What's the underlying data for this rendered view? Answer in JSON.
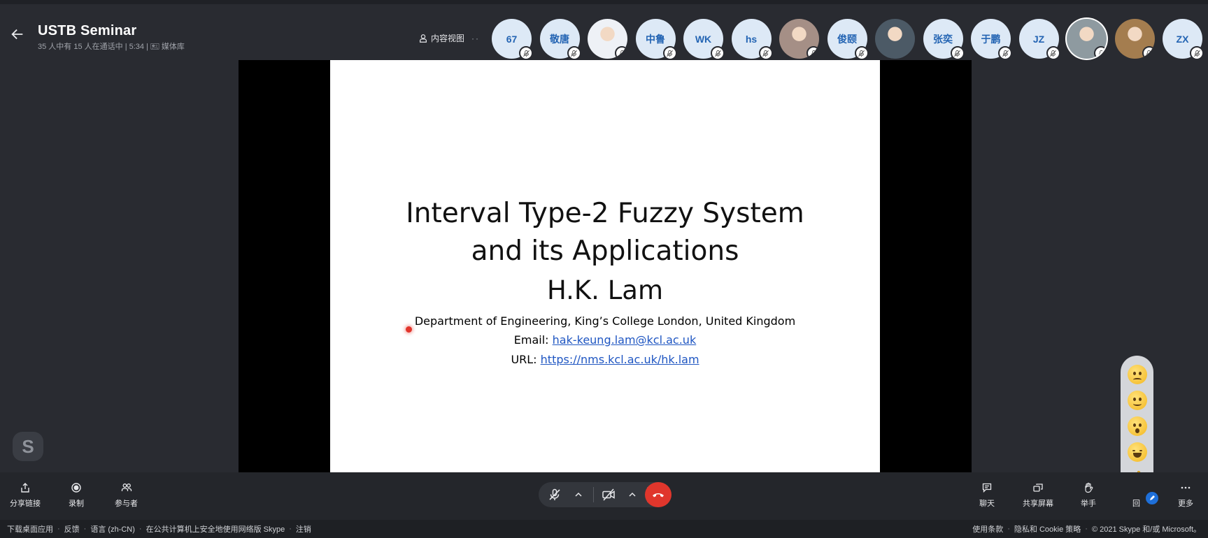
{
  "header": {
    "title": "USTB Seminar",
    "subtitle": "35 人中有 15 人在通话中 | 5:34 | 🖭 媒体库",
    "content_view_label": "内容视图"
  },
  "participants": [
    {
      "initials": "67",
      "photo": false
    },
    {
      "initials": "敬唐",
      "photo": false
    },
    {
      "initials": "",
      "photo": true,
      "bg": "#eef1f6"
    },
    {
      "initials": "中鲁",
      "photo": false
    },
    {
      "initials": "WK",
      "photo": false
    },
    {
      "initials": "hs",
      "photo": false
    },
    {
      "initials": "",
      "photo": true,
      "bg": "#a58f86"
    },
    {
      "initials": "俊颐",
      "photo": false
    },
    {
      "initials": "",
      "photo": true,
      "bg": "#4c5a66"
    },
    {
      "initials": "张奕",
      "photo": false
    },
    {
      "initials": "于鹏",
      "photo": false
    },
    {
      "initials": "JZ",
      "photo": false
    },
    {
      "initials": "",
      "photo": true,
      "bg": "#8e9aa0"
    },
    {
      "initials": "",
      "photo": true,
      "bg": "#a47d4f"
    },
    {
      "initials": "ZX",
      "photo": false
    }
  ],
  "slide": {
    "title_line1": "Interval Type-2 Fuzzy System",
    "title_line2": "and its Applications",
    "author": "H.K. Lam",
    "department": "Department of Engineering, King’s College London, United Kingdom",
    "email_label": "Email: ",
    "email": "hak-keung.lam@kcl.ac.uk",
    "url_label": "URL: ",
    "url": "https://nms.kcl.ac.uk/hk.lam"
  },
  "toolbar": {
    "share_link": "分享链接",
    "record": "录制",
    "participants": "参与者",
    "chat": "聊天",
    "share_screen": "共享屏幕",
    "raise_hand": "举手",
    "react": "回",
    "more": "更多"
  },
  "footer": {
    "download": "下载桌面应用",
    "feedback": "反馈",
    "language": "语言 (zh-CN)",
    "safety": "在公共计算机上安全地使用网络版 Skype",
    "signout": "注销",
    "terms": "使用条款",
    "privacy": "隐私和 Cookie 策略",
    "copyright": "© 2021 Skype 和/或 Microsoft。"
  },
  "colors": {
    "background": "#292b31",
    "accent": "#2364b3",
    "hangup": "#e0362c",
    "link": "#1f56c2"
  }
}
